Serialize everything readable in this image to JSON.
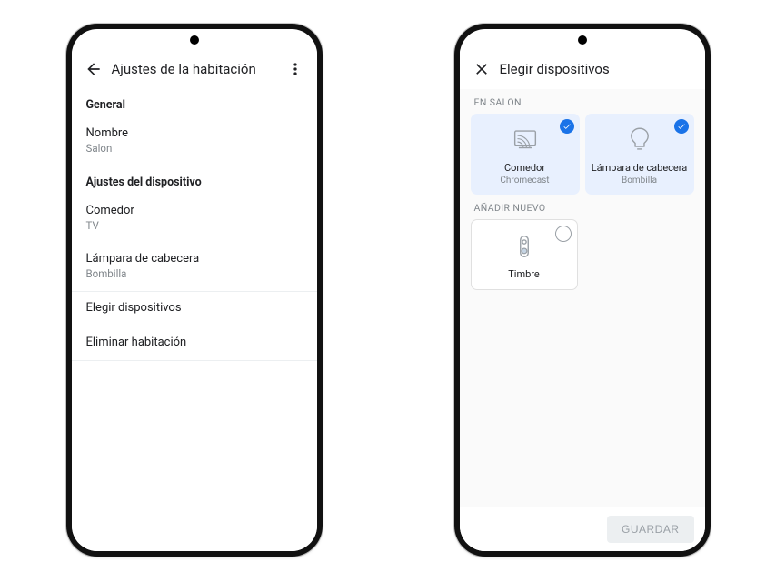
{
  "left": {
    "header": {
      "title": "Ajustes de la habitación"
    },
    "sections": [
      {
        "label": "General",
        "items": [
          {
            "title": "Nombre",
            "sub": "Salon"
          }
        ]
      },
      {
        "label": "Ajustes del dispositivo",
        "items": [
          {
            "title": "Comedor",
            "sub": "TV"
          },
          {
            "title": "Lámpara de cabecera",
            "sub": "Bombilla"
          }
        ]
      }
    ],
    "actions": [
      "Elegir dispositivos",
      "Eliminar habitación"
    ]
  },
  "right": {
    "header": {
      "title": "Elegir dispositivos"
    },
    "groups": [
      {
        "label": "EN SALON",
        "tiles": [
          {
            "name": "Comedor",
            "sub": "Chromecast",
            "selected": true,
            "icon": "cast-tv-icon"
          },
          {
            "name": "Lámpara de cabecera",
            "sub": "Bombilla",
            "selected": true,
            "icon": "bulb-icon"
          }
        ]
      },
      {
        "label": "AÑADIR NUEVO",
        "tiles": [
          {
            "name": "Timbre",
            "selected": false,
            "icon": "doorbell-icon"
          }
        ]
      }
    ],
    "save_label": "GUARDAR"
  }
}
